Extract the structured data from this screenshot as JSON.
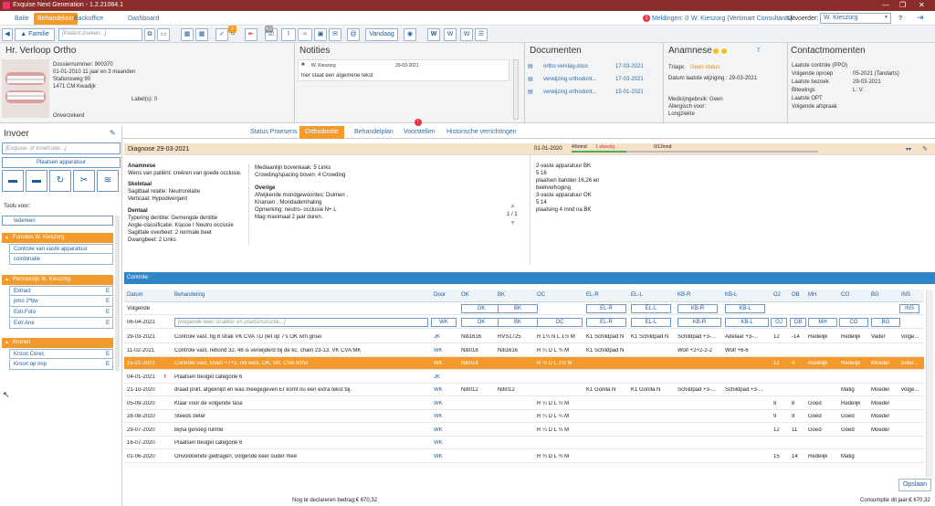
{
  "window": {
    "title": "Exquise Next Generation - 1.2.21084.1"
  },
  "top_tabs": [
    "Balie",
    "Behandelaar",
    "Backoffice",
    "Dashboard"
  ],
  "header": {
    "notifications": "Meldingen: 0",
    "user": "W. Kieszorg (Vertimart Consultants)",
    "executor_label": "Uitvoerder:",
    "executor_value": "W. Kieszorg",
    "help": "?",
    "notif_count": "1"
  },
  "toolbar": {
    "familie": "Familie",
    "search_placeholder": "[Patiënt zoeken...]",
    "vandaag": "Vandaag",
    "badge1": "3",
    "badge2": "4,5"
  },
  "patient": {
    "name": "Hr. Verloop Ortho",
    "dossier": "Dossiernummer: 900370",
    "dob": "01-01-2010 11 jaar en 3 maanden",
    "street": "Stationsweg 90",
    "city": "1471 CM Kwadijk",
    "labels": "Label(s): 0",
    "insurance": "Onverzekerd"
  },
  "notities": {
    "title": "Notities",
    "author": "W. Kieszorg",
    "date": "29-03-2021",
    "text": "hier staat een algemene tekst"
  },
  "documenten": {
    "title": "Documenten",
    "items": [
      {
        "name": "ortho verslag.docx",
        "date": "17-03-2021"
      },
      {
        "name": "verwijzing orthodont...",
        "date": "17-03-2021"
      },
      {
        "name": "verwijzing orthodont...",
        "date": "15-01-2021"
      }
    ]
  },
  "anamnese": {
    "title": "Anamnese",
    "t": "T",
    "triage_label": "Triage:",
    "triage_value": "Geen status",
    "last_change": "Datum laatste wijziging : 29-03-2021",
    "medication": "Medicijngebruik: Geen",
    "allergy": "Allergisch voor:",
    "condition": "Longziekte"
  },
  "contact": {
    "title": "Contactmomenten",
    "rows": [
      {
        "k": "Laatste controle (PPO)",
        "v": ""
      },
      {
        "k": "Volgende oproep",
        "v": "05-2021 (Tandarts)"
      },
      {
        "k": "Laatste bezoek",
        "v": "29-03-2021"
      },
      {
        "k": "Bitewings",
        "v": "L:    V:"
      },
      {
        "k": "Laatste OPT",
        "v": ""
      },
      {
        "k": "Volgende afspraak",
        "v": ""
      }
    ]
  },
  "subtabs": [
    "Status Praesens",
    "Orthodontie",
    "Behandelplan",
    "Voorstellen",
    "Historische verrichtingen"
  ],
  "sidebar": {
    "title": "Invoer",
    "code_placeholder": "[Exquise- of tonefcode...]",
    "plaatsen": "Plaatsen apparatuur",
    "tools_label": "Tools voor:",
    "iedereen": "Iedereen",
    "groups": [
      {
        "title": "Functies W. Kieszorg",
        "items": [
          "Controle van vaste apparatuur",
          "combinatie"
        ]
      },
      {
        "title": "Persoonlijk W. Kieszorg",
        "items": [
          "Extract",
          "pmo 2*bw",
          "Extr.Foto",
          "Extr.Ane"
        ]
      },
      {
        "title": "Kronen",
        "items": [
          "Kroon Cerec",
          "Kroon op Imp"
        ]
      }
    ]
  },
  "diagnose": {
    "title": "Diagnose 29-03-2021",
    "date2": "01-01-2020",
    "timeline": "4/6mnd",
    "afwijzig": "1 afwezig",
    "months": "0/12mnd",
    "pager": "1 / 1",
    "anamnese_h": "Anamnese",
    "anamnese_t": "Wens van patiënt: creëren van goede occlusie.",
    "skeletaal_h": "Skeletaal",
    "skeletaal_1": "Sagittaal relatie: Neutrorelatie",
    "skeletaal_2": "Verticaal: Hypodivergent",
    "dentaal_h": "Dentaal",
    "dentaal_1": "Typering dentitie: Gemengde dentitie",
    "dentaal_2": "Angle-classificatie: Klasse I Neutro occlusie",
    "dentaal_3": "Sagittale overbeet: 2 normale beet",
    "dentaal_4": "Dwangbeet: 2 Links",
    "mid_1": "Mediaanlijn bovenkaak: 5 Links",
    "mid_2": "Crowding/spacing boven: 4 Crowding",
    "overige_h": "Overige",
    "overige_1": "Afwijkende mondgewoontes: Duimen ,",
    "overige_2": "Knarsen , Mondademhaling",
    "overige_3": "Opmerking: neutro- occlusie N+ L",
    "overige_4": " Mag maximaal 2 jaar duren.",
    "right": [
      "2-vaste apparatuur BK",
      "5 16",
      "plaatsen banden 16,26  en",
      "beetverhoging",
      "3-vaste apparatuur OK",
      "5 14",
      "plaatsing 4 mnd na BK"
    ]
  },
  "controle": {
    "title": "Controle:",
    "opslaan": "Opslaan",
    "columns": [
      "Datum",
      "Behandeling",
      "Door",
      "OK",
      "BK",
      "OC",
      "EL-R",
      "EL-L",
      "KB-R",
      "KB-L",
      "OJ",
      "OB",
      "MH",
      "CO",
      "BG",
      "INS"
    ],
    "volgende": "Volgende",
    "next_date": "06-04-2021",
    "next_placeholder": "[volgende keer strakker en poetsinstructie...]",
    "next_door": "WK",
    "rows": [
      [
        "29-03-2021",
        "Controle vast, fig 8 strak  VK CVA TD (let op 7's OK ivm groei",
        "JK",
        "Niti1616",
        "RVS1725",
        "R 1½ N L 1½ M",
        "K1 Schildpad N",
        "K1 Schildpad N",
        "Schildpad +3-...",
        "Adelaar +3-...",
        "12",
        "-14",
        "Redelijk",
        "Redelijk",
        "Vader",
        "volge..."
      ],
      [
        "11-02-2021",
        "Controle vast, rebond 32.  48 is verwijderd bij de kc. chain 23-13. VK CVA MK",
        "WK",
        "Niti018",
        "Niti1616",
        "R ¼ D L ¾ M",
        "K1 Schildpad N",
        "",
        "Wolf +2+2-2-2",
        "Wolf +6-6",
        "",
        "",
        "",
        "",
        "",
        ""
      ],
      [
        "15-01-2021",
        "Controle vast, chain +7+2, niti wiss. OK,  VK: CVA ortho",
        "WK",
        "Niti018",
        "",
        "R ½ D L 1½ M",
        "",
        "",
        "",
        "",
        "12",
        "4",
        "Redelijk",
        "Redelijk",
        "Moeder",
        "beter..."
      ],
      [
        "04-01-2021",
        "Plaatsen beugel categorie 6",
        "JK",
        "",
        "",
        "",
        "",
        "",
        "",
        "",
        "",
        "",
        "",
        "",
        "",
        ""
      ],
      [
        "21-10-2020",
        "draad prikt, afgeknipt en was meegegeven Er komt nu een extra  tekst bij.",
        "WK",
        "Niti012",
        "Niti012",
        "",
        "K1 Gorilla N",
        "K1 Gorilla N",
        "Schildpad +3-...",
        "Schildpad +3-...",
        "",
        "",
        "",
        "Matig",
        "Moeder",
        "volge..."
      ],
      [
        "05-09-2020",
        "Klaar voor de volgende fase",
        "WK",
        "",
        "",
        "R ¼ D L ½ M",
        "",
        "",
        "",
        "",
        "8",
        "8",
        "Goed",
        "Redelijk",
        "Moeder",
        ""
      ],
      [
        "28-08-2020",
        "Steeds beter",
        "WK",
        "",
        "",
        "R ¼ D L ¼ M",
        "",
        "",
        "",
        "",
        "9",
        "9",
        "Goed",
        "Goed",
        "Moeder",
        ""
      ],
      [
        "29-07-2020",
        "Bijna genoeg ruimte",
        "WK",
        "",
        "",
        "R ¼ D L ½ M",
        "",
        "",
        "",
        "",
        "12",
        "11",
        "Goed",
        "Goed",
        "Moeder",
        ""
      ],
      [
        "16-07-2020",
        "Plaatsen beugel categorie 6",
        "WK",
        "",
        "",
        "",
        "",
        "",
        "",
        "",
        "",
        "",
        "",
        "",
        "",
        ""
      ],
      [
        "01-06-2020",
        "Onvoldoende gedragen, volgende keer ouder mee",
        "WK",
        "",
        "",
        "R ¾ D L ¾ M",
        "",
        "",
        "",
        "",
        "15",
        "14",
        "Redelijk",
        "Matig",
        "",
        ""
      ]
    ]
  },
  "footer": {
    "left": "Nog te declareren bedrag:€ 670,32",
    "right": "Consumptie dit jaar:€ 670,32"
  }
}
